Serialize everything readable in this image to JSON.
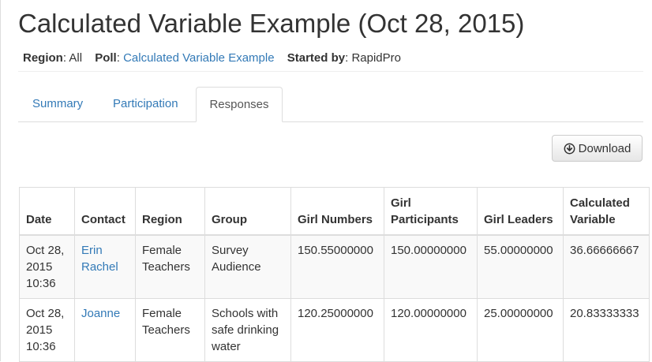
{
  "page": {
    "title": "Calculated Variable Example (Oct 28, 2015)"
  },
  "meta": {
    "region_label": "Region",
    "region_value": "All",
    "poll_label": "Poll",
    "poll_value": "Calculated Variable Example",
    "started_label": "Started by",
    "started_value": "RapidPro"
  },
  "tabs": [
    {
      "label": "Summary",
      "active": false
    },
    {
      "label": "Participation",
      "active": false
    },
    {
      "label": "Responses",
      "active": true
    }
  ],
  "toolbar": {
    "download_label": "Download",
    "download_icon": "download-circle-icon"
  },
  "table": {
    "headers": {
      "date": "Date",
      "contact": "Contact",
      "region": "Region",
      "group": "Group",
      "girl_numbers": "Girl Numbers",
      "girl_participants": "Girl Participants",
      "girl_leaders": "Girl Leaders",
      "calculated_variable": "Calculated Variable"
    },
    "rows": [
      {
        "date": "Oct 28, 2015 10:36",
        "contact": "Erin Rachel",
        "region": "Female Teachers",
        "group": "Survey Audience",
        "girl_numbers": "150.55000000",
        "girl_participants": "150.00000000",
        "girl_leaders": "55.00000000",
        "calculated_variable": "36.66666667"
      },
      {
        "date": "Oct 28, 2015 10:36",
        "contact": "Joanne",
        "region": "Female Teachers",
        "group": "Schools with safe drinking water",
        "girl_numbers": "120.25000000",
        "girl_participants": "120.00000000",
        "girl_leaders": "25.00000000",
        "calculated_variable": "20.83333333"
      }
    ]
  },
  "colors": {
    "link": "#337ab7",
    "text": "#333333",
    "border": "#dddddd"
  }
}
